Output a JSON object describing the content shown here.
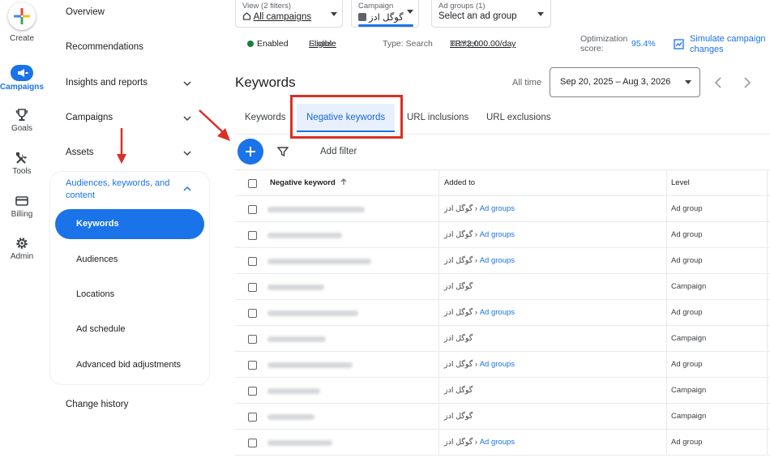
{
  "rail": {
    "create": "Create",
    "campaigns": "Campaigns",
    "goals": "Goals",
    "tools": "Tools",
    "billing": "Billing",
    "admin": "Admin"
  },
  "nav": {
    "overview": "Overview",
    "recommendations": "Recommendations",
    "insights": "Insights and reports",
    "campaigns": "Campaigns",
    "assets": "Assets",
    "audiences_group": "Audiences, keywords, and content",
    "sub": [
      "Keywords",
      "Audiences",
      "Locations",
      "Ad schedule",
      "Advanced bid adjustments"
    ],
    "change_history": "Change history"
  },
  "topbar": {
    "view_label": "View (2 filters)",
    "view_value": "All campaigns",
    "campaign_label": "Campaign",
    "campaign_value": "گوگل ادز",
    "adgroups_label": "Ad groups (1)",
    "adgroups_value": "Select an ad group"
  },
  "status": {
    "enabled": "Enabled",
    "status_label": "Status:",
    "status_value": "Eligible",
    "type": "Type: Search",
    "budget_label": "Budget:",
    "budget_value": "TRY2,000.00/day",
    "opt_label_1": "Optimization",
    "opt_label_2": "score:",
    "opt_value": "95.4%",
    "simulate_1": "Simulate campaign",
    "simulate_2": "changes"
  },
  "page": {
    "title": "Keywords",
    "all_time": "All time",
    "date_range": "Sep 20, 2025 – Aug 3, 2026"
  },
  "tabs": [
    "Keywords",
    "Negative keywords",
    "URL inclusions",
    "URL exclusions"
  ],
  "toolbar": {
    "add_filter": "Add filter"
  },
  "table": {
    "headers": {
      "keyword": "Negative keyword",
      "added_to": "Added to",
      "level": "Level"
    },
    "rows": [
      {
        "added_to": "گوگل ادز",
        "ad_groups": "Ad groups",
        "level": "Ad group"
      },
      {
        "added_to": "گوگل ادز",
        "ad_groups": "Ad groups",
        "level": "Ad group"
      },
      {
        "added_to": "گوگل ادز",
        "ad_groups": "Ad groups",
        "level": "Ad group"
      },
      {
        "added_to": "گوگل ادز",
        "ad_groups": "",
        "level": "Campaign"
      },
      {
        "added_to": "گوگل ادز",
        "ad_groups": "Ad groups",
        "level": "Ad group"
      },
      {
        "added_to": "گوگل ادز",
        "ad_groups": "",
        "level": "Campaign"
      },
      {
        "added_to": "گوگل ادز",
        "ad_groups": "Ad groups",
        "level": "Ad group"
      },
      {
        "added_to": "گوگل ادز",
        "ad_groups": "",
        "level": "Campaign"
      },
      {
        "added_to": "گوگل ادز",
        "ad_groups": "",
        "level": "Campaign"
      },
      {
        "added_to": "گوگل ادز",
        "ad_groups": "Ad groups",
        "level": "Ad group"
      }
    ]
  },
  "colors": {
    "accent": "#1a73e8",
    "annotation": "#d93025",
    "enabled": "#188038"
  }
}
